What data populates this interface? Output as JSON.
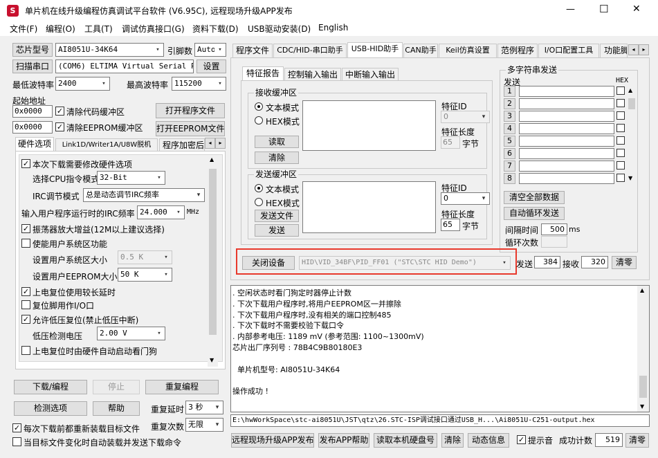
{
  "app": {
    "title": "单片机在线升级编程仿真调试平台软件 (V6.95C), 远程现场升级APP发布",
    "min": "—",
    "max": "☐",
    "close": "✕"
  },
  "menu": [
    "文件(F)",
    "编程(O)",
    "工具(T)",
    "调试仿真接口(G)",
    "资料下载(D)",
    "USB驱动安装(D)",
    "English"
  ],
  "left": {
    "chip_model_btn": "芯片型号",
    "chip_model": "AI8051U-34K64",
    "pins_label": "引脚数",
    "pins": "Auto",
    "scan_btn": "扫描串口",
    "port": "(COM6) ELTIMA Virtual Serial P",
    "settings_btn": "设置",
    "min_baud_label": "最低波特率",
    "min_baud": "2400",
    "max_baud_label": "最高波特率",
    "max_baud": "115200",
    "start_addr_label": "起始地址",
    "addr1": "0x0000",
    "clear_code_label": "清除代码缓冲区",
    "open_prog_btn": "打开程序文件",
    "addr2": "0x0000",
    "clear_eeprom_label": "清除EEPROM缓冲区",
    "open_eeprom_btn": "打开EEPROM文件",
    "tabs": [
      "硬件选项",
      "Link1D/Writer1A/U8W脱机",
      "程序加密后"
    ],
    "hw": {
      "need_modify": "本次下载需要修改硬件选项",
      "cpu_mode_label": "选择CPU指令模式",
      "cpu_mode": "32-Bit",
      "irc_mode_label": "IRC调节模式",
      "irc_mode": "总是动态调节IRC频率",
      "freq_label": "输入用户程序运行时的IRC频率",
      "freq": "24.000",
      "freq_unit": "MHz",
      "osc_gain": "振荡器放大增益(12M以上建议选择)",
      "user_sys": "使能用户系统区功能",
      "user_sys_size_label": "设置用户系统区大小",
      "user_sys_size": "0.5 K",
      "eeprom_size_label": "设置用户EEPROM大小",
      "eeprom_size": "50   K",
      "long_reset": "上电复位使用较长延时",
      "reset_io": "复位脚用作I/O口",
      "allow_lvr": "允许低压复位(禁止低压中断)",
      "lvd_label": "低压检测电压",
      "lvd": "2.00 V",
      "wdt_auto": "上电复位时由硬件自动启动看门狗"
    },
    "download_btn": "下载/编程",
    "stop_btn": "停止",
    "reprogram_btn": "重复编程",
    "detect_btn": "检测选项",
    "help_btn": "帮助",
    "repeat_delay_label": "重复延时",
    "repeat_delay": "3 秒",
    "repeat_count_label": "重复次数",
    "repeat_count": "无限",
    "reload_label": "每次下载前都重新装载目标文件",
    "auto_load_label": "当目标文件变化时自动装载并发送下载命令"
  },
  "right": {
    "tabs": [
      "程序文件",
      "CDC/HID-串口助手",
      "USB-HID助手",
      "CAN助手",
      "Keil仿真设置",
      "范例程序",
      "I/O口配置工具",
      "功能脚"
    ],
    "subtabs": [
      "特征报告",
      "控制输入输出",
      "中断输入输出"
    ],
    "recv": {
      "title": "接收缓冲区",
      "text_mode": "文本模式",
      "hex_mode": "HEX模式",
      "read_btn": "读取",
      "clear_btn": "清除",
      "feature_id_label": "特征ID",
      "feature_id": "0",
      "feature_len_label": "特征长度",
      "feature_len": "65",
      "unit": "字节"
    },
    "send": {
      "title": "发送缓冲区",
      "text_mode": "文本模式",
      "hex_mode": "HEX模式",
      "send_file_btn": "发送文件",
      "send_btn": "发送",
      "feature_id_label": "特征ID",
      "feature_id": "0",
      "feature_len_label": "特征长度",
      "feature_len": "65",
      "unit": "字节"
    },
    "close_device_btn": "关闭设备",
    "device": "HID\\VID_34BF\\PID_FF01 (\"STC\\STC HID Demo\")",
    "multi": {
      "title": "多字符串发送",
      "send_col": "发送",
      "hex_col": "HEX",
      "rows": [
        "1",
        "2",
        "3",
        "4",
        "5",
        "6",
        "7",
        "8"
      ],
      "clear_all_btn": "清空全部数据",
      "auto_loop_btn": "自动循环发送",
      "interval_label": "间隔时间",
      "interval": "500",
      "interval_unit": "ms",
      "loops_label": "循环次数"
    },
    "sent_label": "发送",
    "sent": "384",
    "recv_label": "接收",
    "recv_count": "320",
    "clear_count_btn": "清零",
    "log": [
      ". 空闲状态时看门狗定时器停止计数",
      ". 下次下载用户程序时,将用户EEPROM区一并擦除",
      ". 下次下载用户程序时,没有相关的端口控制485",
      ". 下次下载时不需要校验下载口令",
      ". 内部参考电压: 1189 mV (参考范围: 1100~1300mV)",
      "芯片出厂序列号 : 78B4C9B80180E3",
      "",
      "  单片机型号: AI8051U-34K64",
      "",
      "操作成功 !"
    ],
    "path": "E:\\hwWorkSpace\\stc-ai8051U\\JST\\qtz\\26.STC-ISP调试接口通过USB_H...\\Ai8051U-C251-output.hex",
    "publish_btn": "远程现场升级APP发布",
    "publish_help_btn": "发布APP帮助",
    "read_disk_btn": "读取本机硬盘号",
    "clear_btn": "清除",
    "dyn_info_btn": "动态信息",
    "beep_label": "提示音",
    "success_label": "成功计数",
    "success_count": "519",
    "clear_success_btn": "清零"
  },
  "colors": {
    "highlight": "#e8392c",
    "titlebar_icon": "#c8102e"
  }
}
